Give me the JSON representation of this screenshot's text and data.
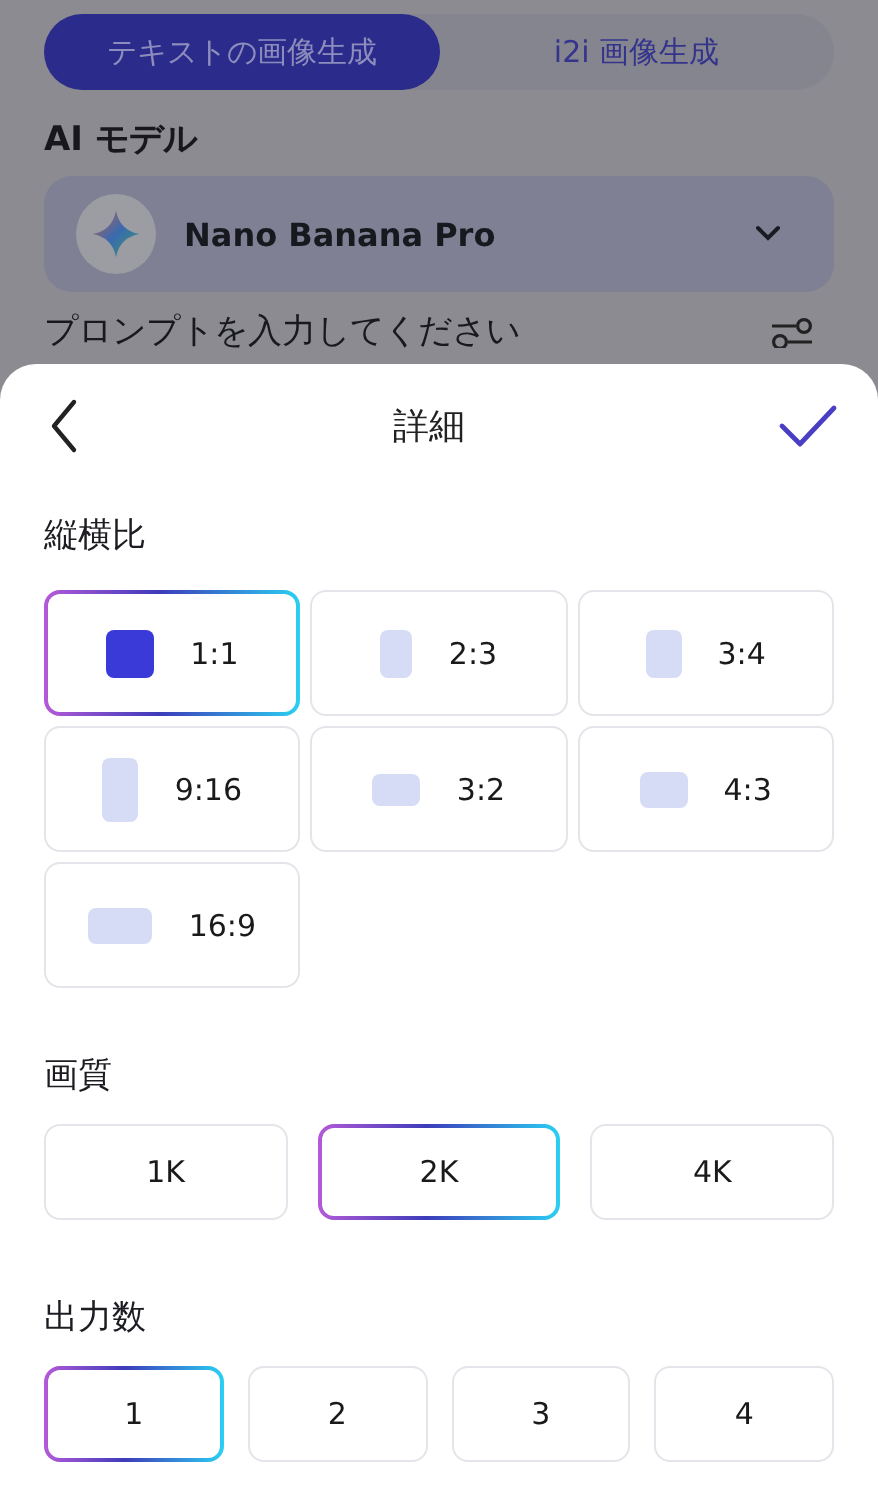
{
  "background": {
    "tabs": [
      {
        "label": "テキストの画像生成",
        "selected": true
      },
      {
        "label": "i2i 画像生成",
        "selected": false
      }
    ],
    "model_label": "AI モデル",
    "model": {
      "value": "Nano Banana Pro"
    },
    "prompt_label": "プロンプトを入力してください"
  },
  "sheet": {
    "title": "詳細",
    "sections": [
      {
        "kind": "ratio",
        "label": "縦横比",
        "options": [
          {
            "label": "1:1",
            "selected": true
          },
          {
            "label": "2:3",
            "selected": false
          },
          {
            "label": "3:4",
            "selected": false
          },
          {
            "label": "9:16",
            "selected": false
          },
          {
            "label": "3:2",
            "selected": false
          },
          {
            "label": "4:3",
            "selected": false
          },
          {
            "label": "16:9",
            "selected": false
          }
        ]
      },
      {
        "kind": "quality",
        "label": "画質",
        "options": [
          {
            "label": "1K",
            "selected": false
          },
          {
            "label": "2K",
            "selected": true
          },
          {
            "label": "4K",
            "selected": false
          }
        ]
      },
      {
        "kind": "count",
        "label": "出力数",
        "options": [
          {
            "label": "1",
            "selected": true
          },
          {
            "label": "2",
            "selected": false
          },
          {
            "label": "3",
            "selected": false
          },
          {
            "label": "4",
            "selected": false
          }
        ]
      }
    ]
  }
}
